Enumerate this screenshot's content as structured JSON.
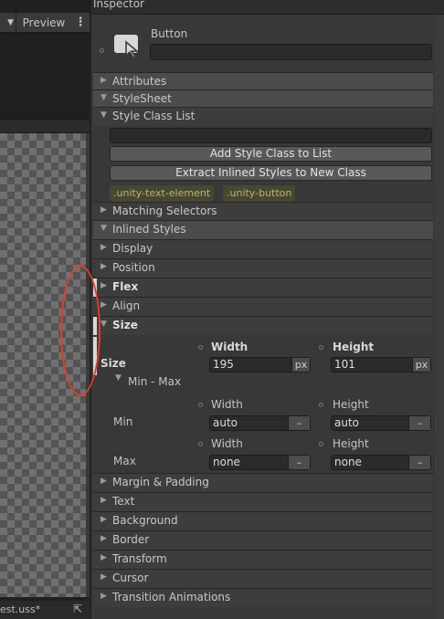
{
  "left_panel": {
    "preview_label": "Preview",
    "status_file": "est.uss*"
  },
  "inspector": {
    "title": "Inspector",
    "element_type": "Button",
    "name_value": "",
    "sections": {
      "attributes": "Attributes",
      "stylesheet": "StyleSheet",
      "style_class_list": "Style Class List",
      "matching_selectors": "Matching Selectors",
      "inlined_styles": "Inlined Styles",
      "display": "Display",
      "position": "Position",
      "flex": "Flex",
      "align": "Align",
      "size": "Size",
      "margin_padding": "Margin & Padding",
      "text": "Text",
      "background": "Background",
      "border": "Border",
      "transform": "Transform",
      "cursor": "Cursor",
      "transition_animations": "Transition Animations"
    },
    "buttons": {
      "add_class": "Add Style Class to List",
      "extract_styles": "Extract Inlined Styles to New Class"
    },
    "class_chips": [
      ".unity-text-element",
      ".unity-button"
    ],
    "size": {
      "row_label": "Size",
      "width_label": "Width",
      "height_label": "Height",
      "width_value": "195",
      "height_value": "101",
      "unit": "px",
      "minmax_label": "Min - Max",
      "min_label": "Min",
      "max_label": "Max",
      "min_width_label": "Width",
      "min_height_label": "Height",
      "min_width": "auto",
      "min_height": "auto",
      "max_width_label": "Width",
      "max_height_label": "Height",
      "max_width": "none",
      "max_height": "none",
      "dash": "–"
    }
  },
  "annotation_color": "#e33d2a"
}
